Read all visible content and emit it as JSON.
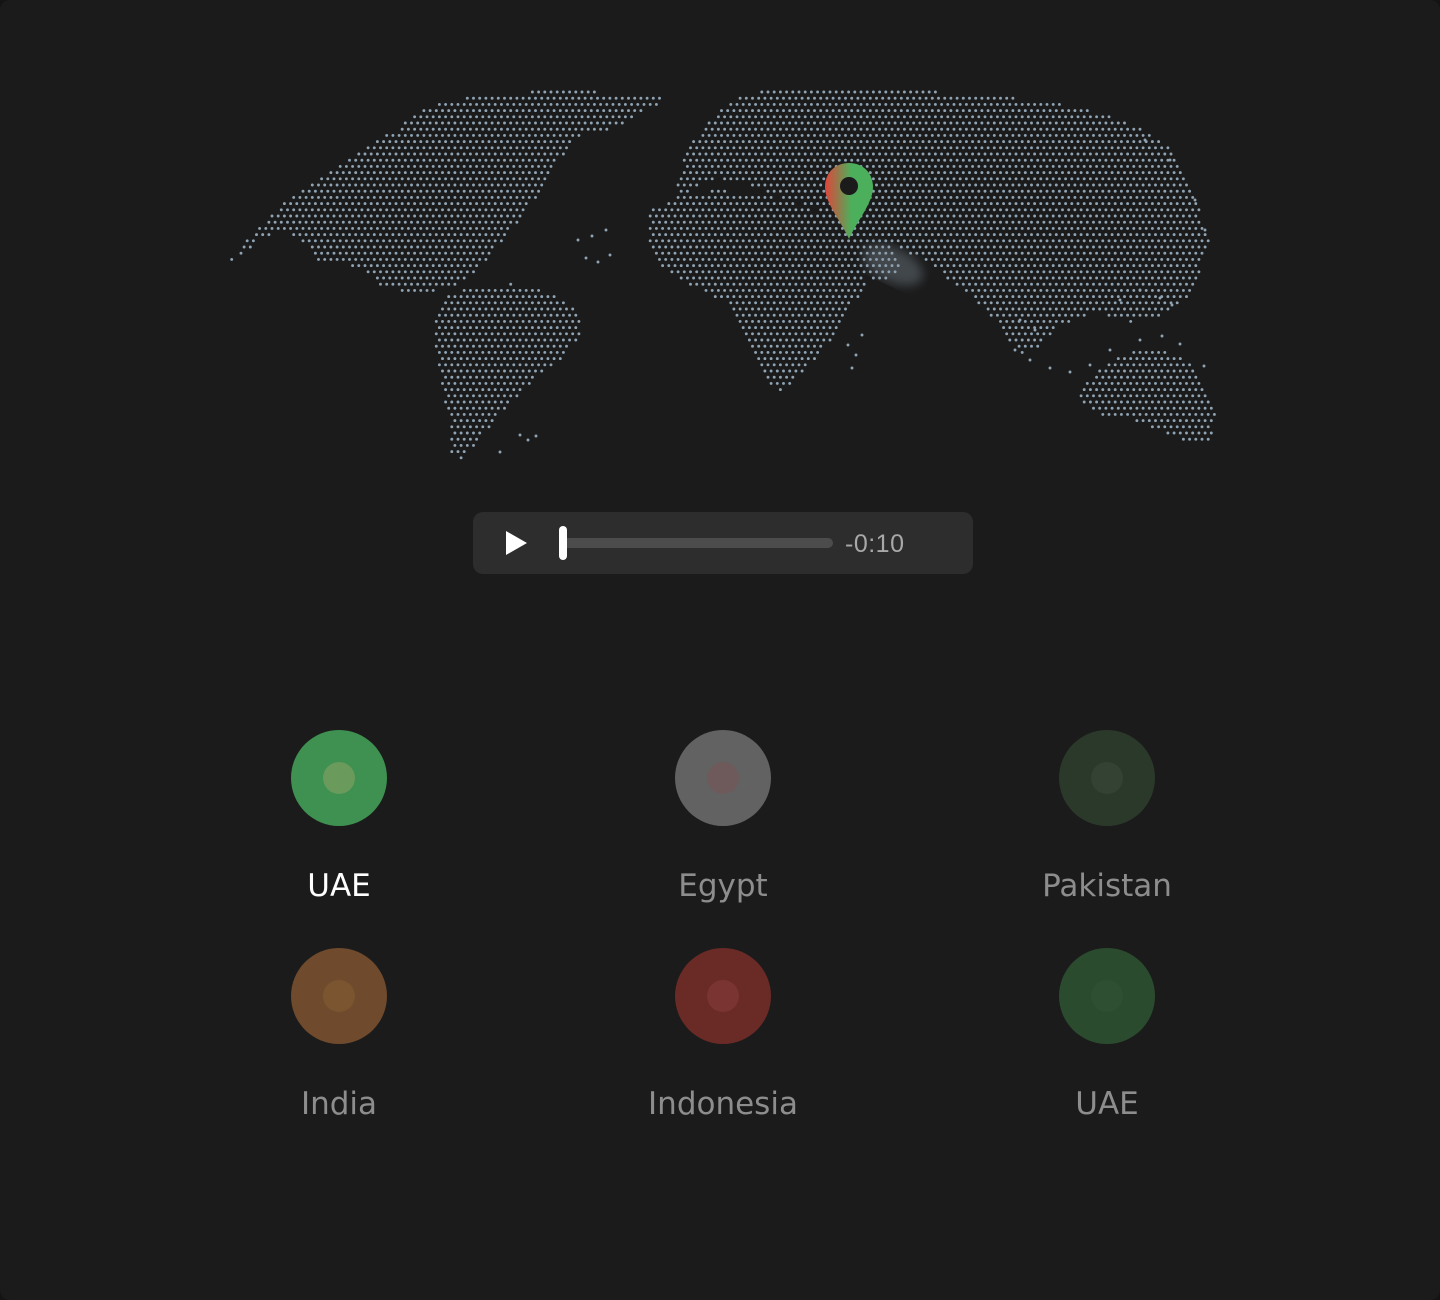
{
  "map": {
    "pin_colors": {
      "left": "#e0453a",
      "right": "#4caf5c"
    },
    "dot_color": "#8fa3b3"
  },
  "player": {
    "play_icon": "play-icon",
    "time_remaining": "-0:10",
    "progress": 0.0
  },
  "options": [
    {
      "label": "UAE",
      "active": true,
      "color": "#3e9150",
      "inner": "#6a9a5c"
    },
    {
      "label": "Egypt",
      "active": false,
      "color": "#626262",
      "inner": "#6e5a5a"
    },
    {
      "label": "Pakistan",
      "active": false,
      "color": "#2b392b",
      "inner": "#334233"
    },
    {
      "label": "India",
      "active": false,
      "color": "#6f4a2c",
      "inner": "#7a5530"
    },
    {
      "label": "Indonesia",
      "active": false,
      "color": "#6a2a26",
      "inner": "#7a3532"
    },
    {
      "label": "UAE",
      "active": false,
      "color": "#2b4b2f",
      "inner": "#2e4f32"
    }
  ]
}
